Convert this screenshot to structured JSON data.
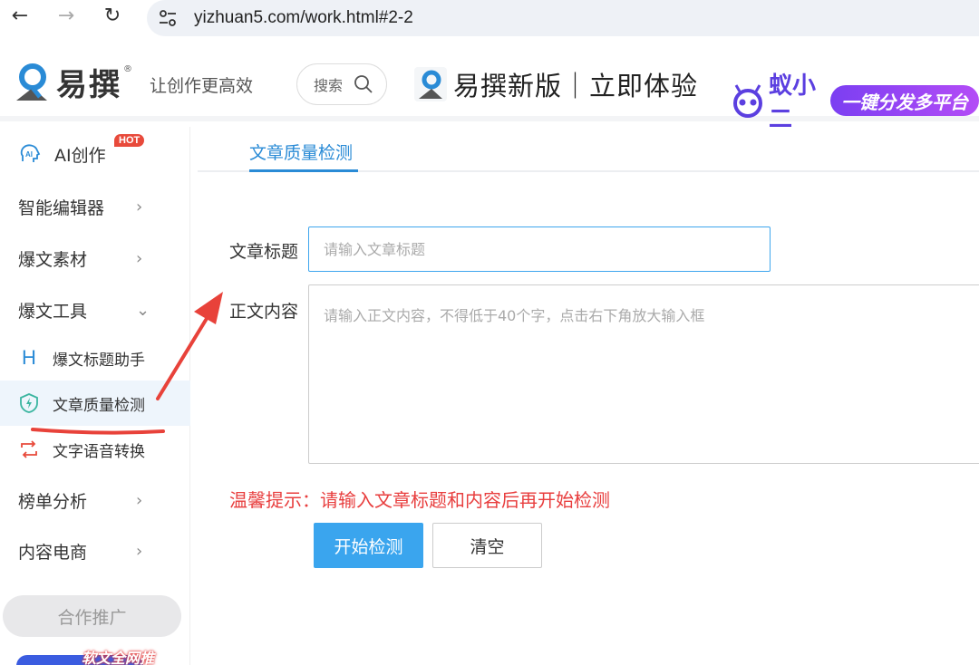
{
  "browser": {
    "url": "yizhuan5.com/work.html#2-2",
    "back_glyph": "←",
    "forward_glyph": "→",
    "reload_glyph": "↻"
  },
  "header": {
    "logo_text": "易撰",
    "logo_reg": "®",
    "slogan": "让创作更高效",
    "search_label": "搜索",
    "promo_new": "易撰新版｜立即体验",
    "promo_ant_name": "蚁小二",
    "promo_ant_badge": "一键分发多平台"
  },
  "sidebar": {
    "ai_label": "AI创作",
    "hot_badge": "HOT",
    "items": [
      {
        "label": "智能编辑器",
        "chevron": "›"
      },
      {
        "label": "爆文素材",
        "chevron": "›"
      },
      {
        "label": "爆文工具",
        "chevron": "⌄"
      }
    ],
    "subitems": [
      {
        "label": "爆文标题助手",
        "icon": "H"
      },
      {
        "label": "文章质量检测"
      },
      {
        "label": "文字语音转换"
      }
    ],
    "items_bottom": [
      {
        "label": "榜单分析",
        "chevron": "›"
      },
      {
        "label": "内容电商",
        "chevron": "›"
      }
    ],
    "coop_label": "合作推广",
    "softad_label": "软文全网推"
  },
  "main": {
    "tab_label": "文章质量检测",
    "title_label": "文章标题",
    "title_placeholder": "请输入文章标题",
    "content_label": "正文内容",
    "content_placeholder": "请输入正文内容，不得低于40个字，点击右下角放大输入框",
    "tip": "温馨提示：请输入文章标题和内容后再开始检测",
    "start_button": "开始检测",
    "clear_button": "清空"
  },
  "colors": {
    "accent": "#2a8bd6",
    "primary_button": "#3aa5ee",
    "warning": "#e83e3e",
    "annotation": "#e8423a"
  }
}
